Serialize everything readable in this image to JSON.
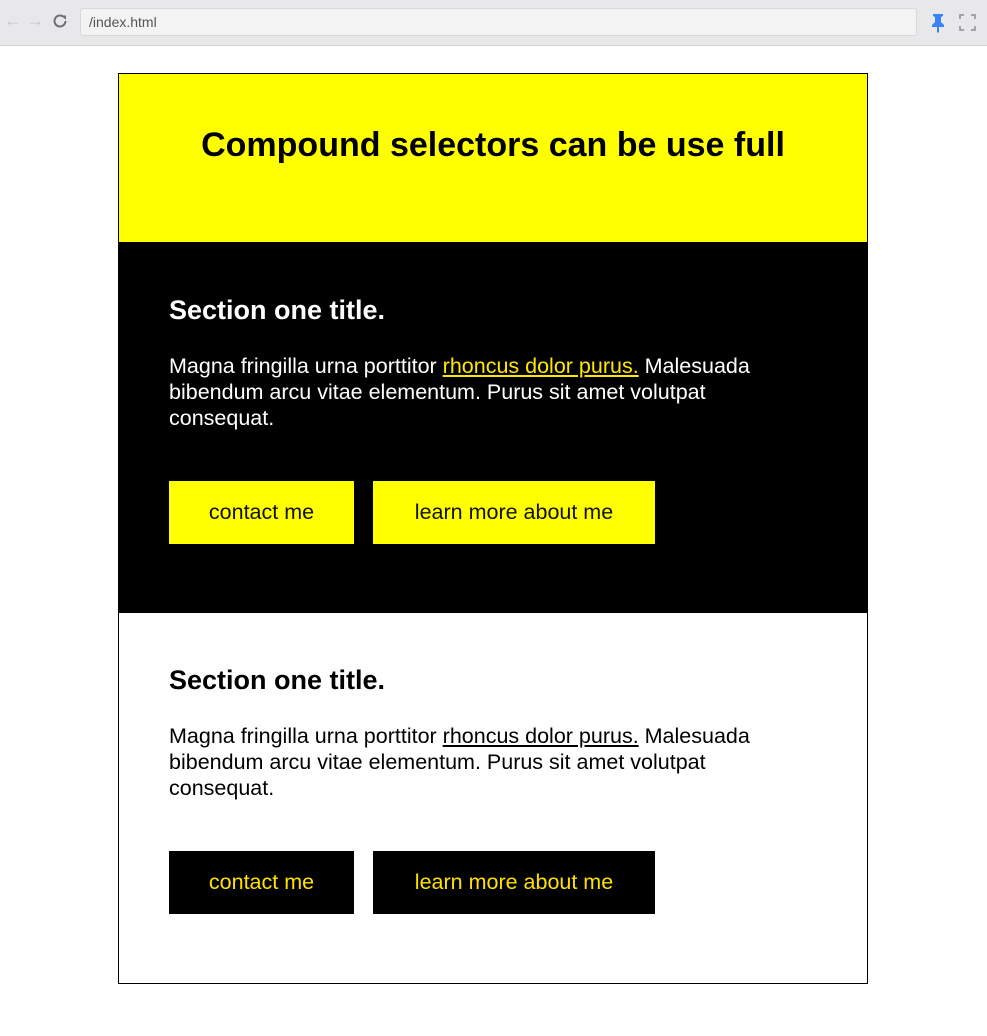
{
  "browser": {
    "address": "/index.html",
    "icons": [
      "back-icon",
      "forward-icon",
      "reload-icon",
      "pin-icon",
      "fullscreen-icon"
    ],
    "pin_color": "#3b82f6"
  },
  "colors": {
    "accent_yellow": "#ffff00",
    "link_yellow": "#ffe600",
    "dark": "#000000",
    "light": "#ffffff"
  },
  "page": {
    "title": "Compound selectors can be use full",
    "sections": [
      {
        "theme": "dark",
        "title": "Section one title.",
        "text_before_link": "Magna fringilla urna porttitor ",
        "link": "rhoncus dolor purus.",
        "text_after_link": " Malesuada bibendum arcu vitae elementum. Purus sit amet volutpat consequat.",
        "buttons": [
          "contact me",
          "learn more about me"
        ]
      },
      {
        "theme": "light",
        "title": "Section one title.",
        "text_before_link": "Magna fringilla urna porttitor ",
        "link": "rhoncus dolor purus.",
        "text_after_link": " Malesuada bibendum arcu vitae elementum. Purus sit amet volutpat consequat.",
        "buttons": [
          "contact me",
          "learn more about me"
        ]
      }
    ]
  }
}
